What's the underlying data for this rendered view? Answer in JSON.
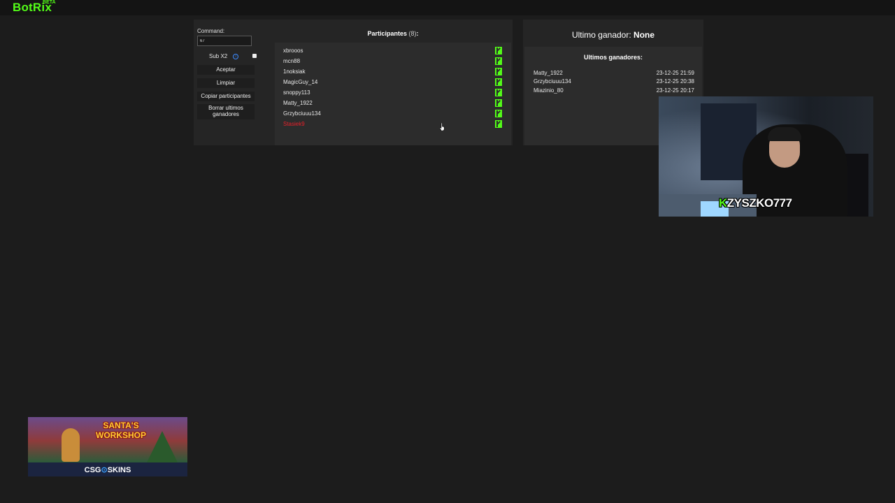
{
  "header": {
    "logo": "BotRix",
    "badge": "BETA"
  },
  "controls": {
    "command_label": "Command:",
    "command_value": "67",
    "sub_label": "Sub X2",
    "buttons": [
      "Aceptar",
      "Limpiar",
      "Copiar participantes",
      "Borrar ultimos ganadores"
    ]
  },
  "participants": {
    "title": "Participantes",
    "count": "(8)",
    "colon": ":",
    "items": [
      "xbrooos",
      "mcn88",
      "1noksiak",
      "MagicGuy_14",
      "snoppy113",
      "Matty_1922",
      "Grzybciuuu134",
      "Stasiek9"
    ],
    "highlight_color": "#e8202a",
    "platform_color": "#53fc18"
  },
  "winner": {
    "label": "Ultimo ganador:",
    "value": "None",
    "history_title": "Ultimos ganadores:",
    "history": [
      {
        "name": "Matty_1922",
        "date": "23-12-25 21:59"
      },
      {
        "name": "Grzybciuuu134",
        "date": "23-12-25 20:38"
      },
      {
        "name": "Miazinio_80",
        "date": "23-12-25 20:17"
      }
    ]
  },
  "webcam": {
    "tag_k": "K",
    "tag_rest": "ZYSZKO777"
  },
  "ad": {
    "title_line1": "SANTA'S",
    "title_line2": "WORKSHOP",
    "brand_left": "CSG",
    "brand_sep": "⊙",
    "brand_right": "SKINS"
  }
}
